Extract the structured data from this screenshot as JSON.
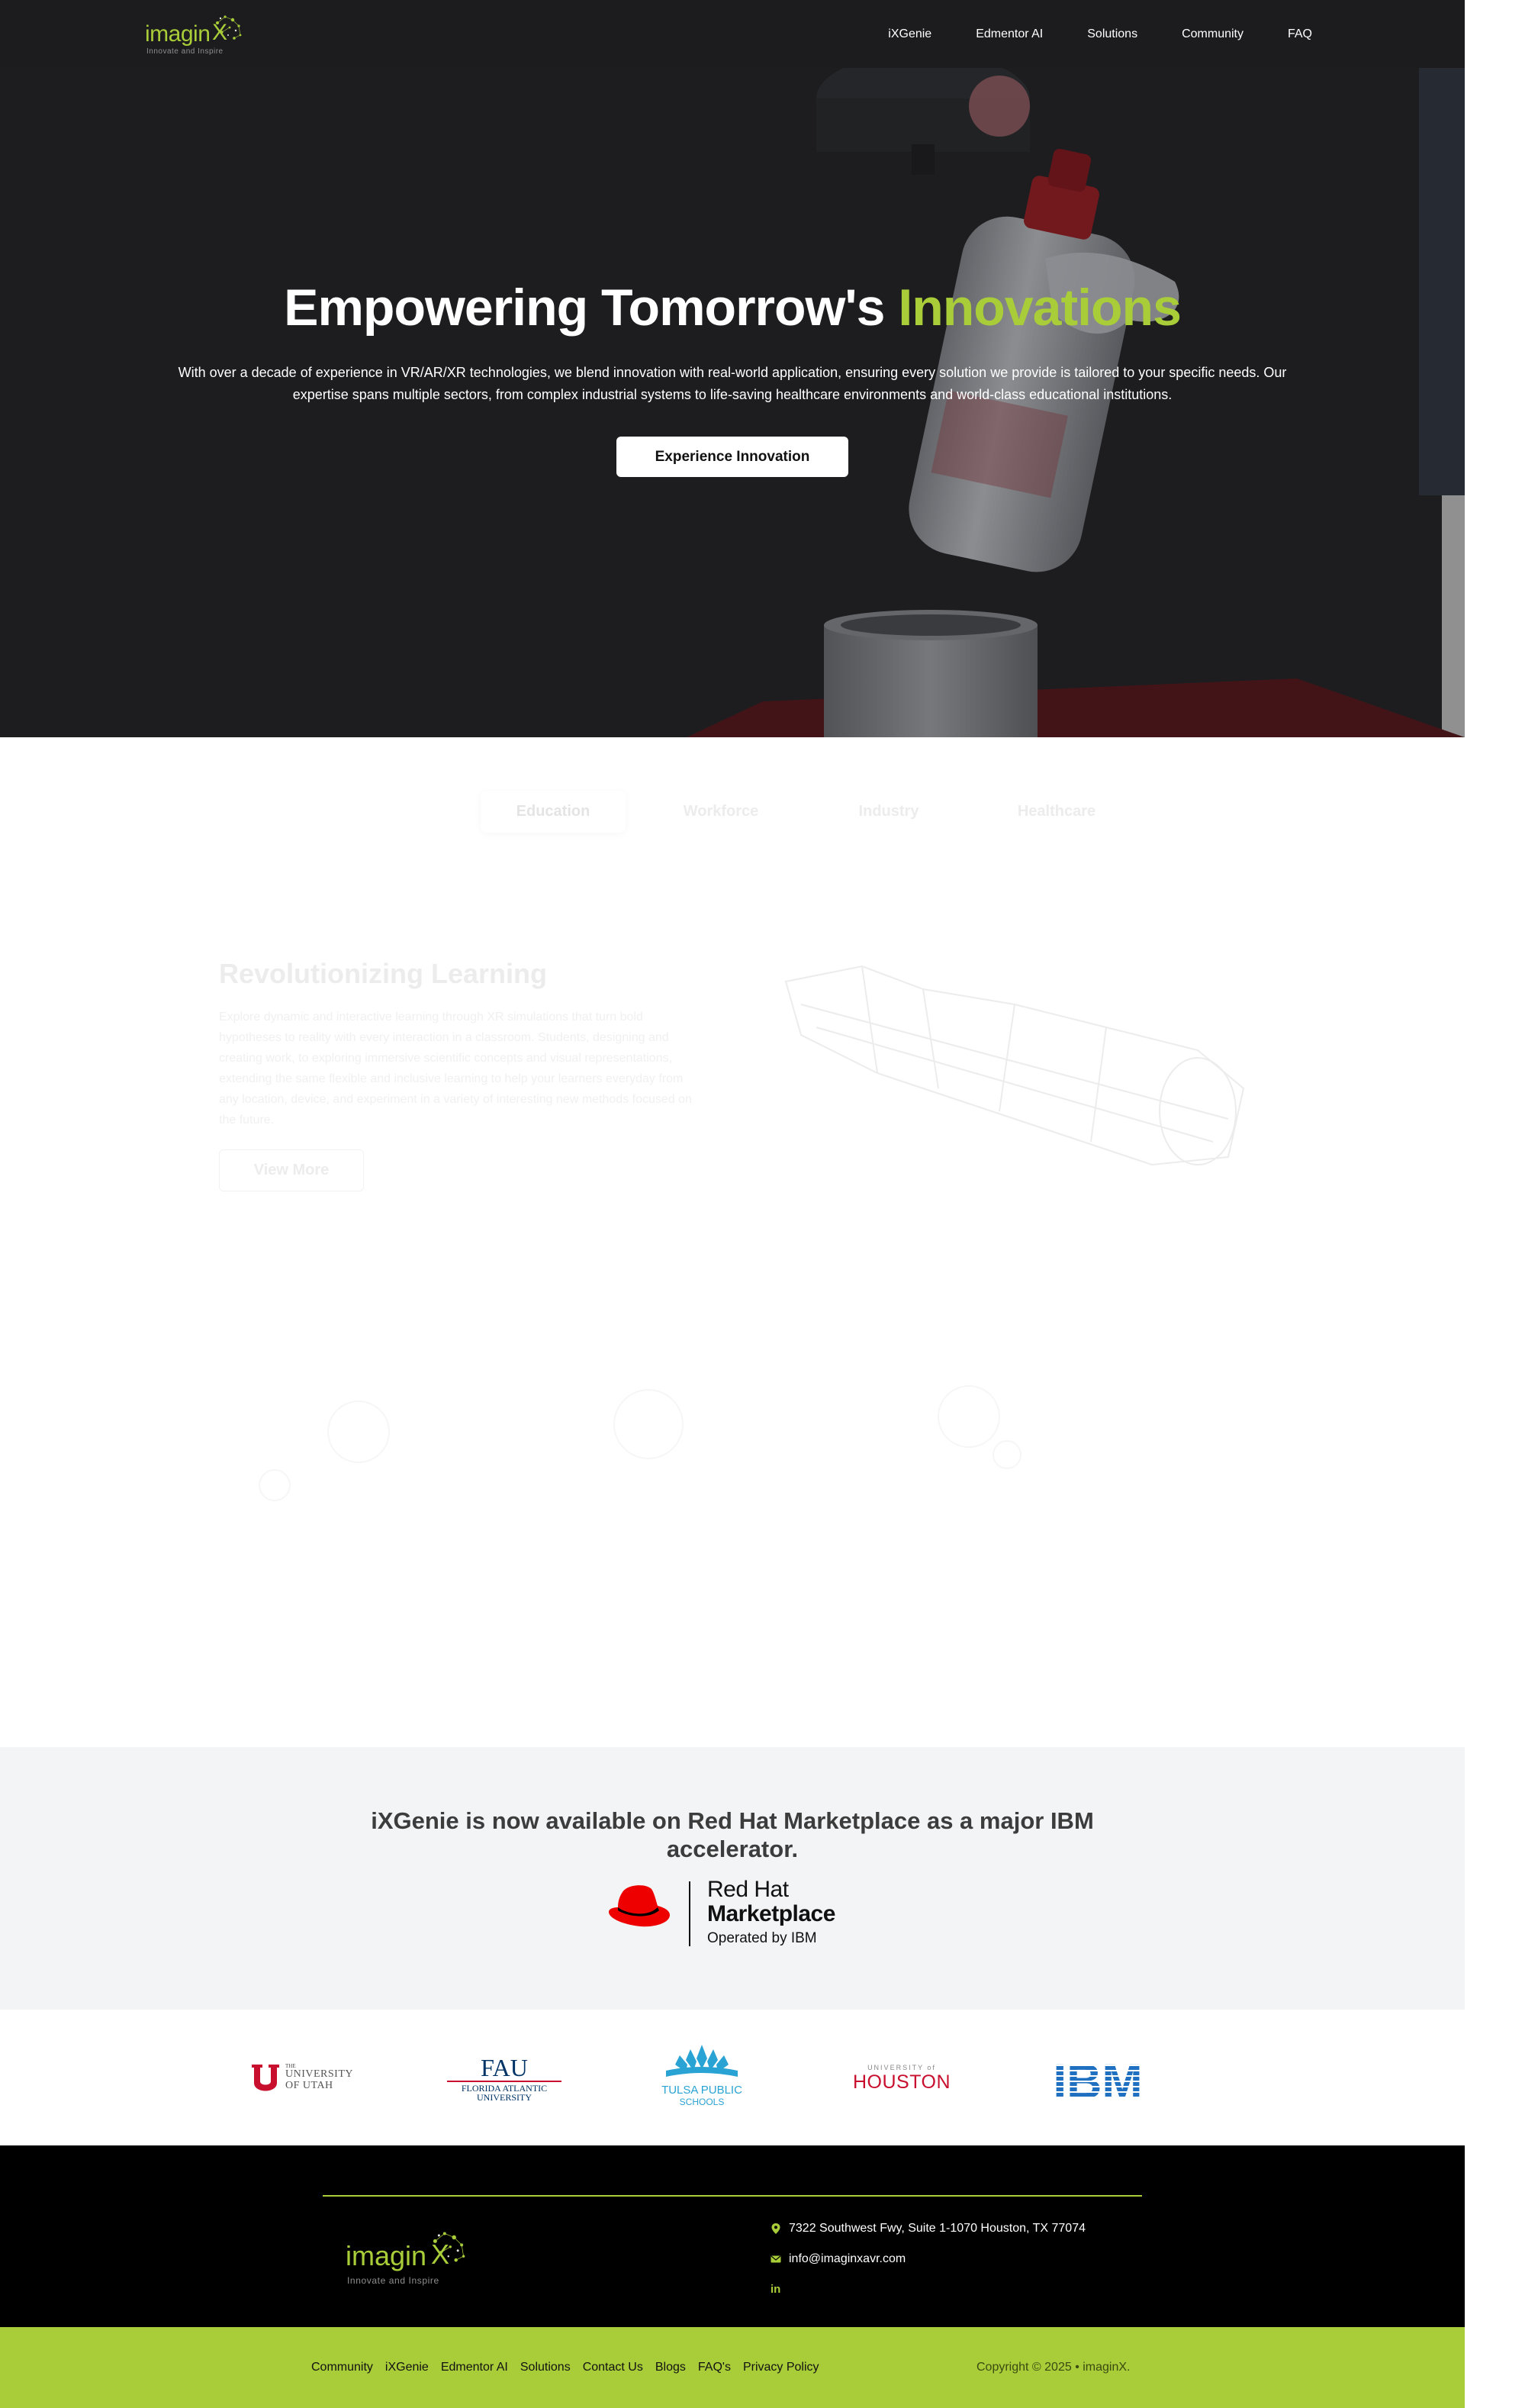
{
  "nav": {
    "logo_word": "imagin",
    "logo_x": "X",
    "logo_tagline": "Innovate and Inspire",
    "links": [
      "iXGenie",
      "Edmentor AI",
      "Solutions",
      "Community",
      "FAQ"
    ]
  },
  "hero": {
    "title_main": "Empowering Tomorrow's ",
    "title_accent": "Innovations",
    "description": "With over a decade of experience in VR/AR/XR technologies, we blend innovation with real-world application, ensuring every solution we provide is tailored to your specific needs. Our expertise spans multiple sectors, from complex industrial systems to life-saving healthcare environments and world-class educational institutions.",
    "cta_label": "Experience Innovation"
  },
  "sectors": {
    "tabs": [
      "Education",
      "Workforce",
      "Industry",
      "Healthcare"
    ],
    "active_tab": "Education",
    "title": "Revolutionizing Learning",
    "body": "Explore dynamic and interactive learning through XR simulations that turn bold hypotheses to reality with every interaction in a classroom. Students, designing and creating work, to exploring immersive scientific concepts and visual representations, extending the same flexible and inclusive learning to help your learners everyday from any location, device, and experiment in a variety of interesting new methods focused on the future.",
    "button_label": "View More"
  },
  "banner": {
    "title": "iXGenie is now available on Red Hat Marketplace as a major IBM accelerator.",
    "rh_line1": "Red Hat",
    "rh_line2": "Marketplace",
    "rh_line3": "Operated by IBM"
  },
  "partners": {
    "utah_small": "THE",
    "utah_line1": "UNIVERSITY",
    "utah_line2": "OF UTAH",
    "fau_mark": "FAU",
    "fau_line1": "FLORIDA ATLANTIC",
    "fau_line2": "UNIVERSITY",
    "tulsa_line1": "TULSA PUBLIC",
    "tulsa_line2": "SCHOOLS",
    "houston_small": "UNIVERSITY of",
    "houston_main": "HOUSTON",
    "ibm": "IBM"
  },
  "footer": {
    "logo_word": "imagin",
    "logo_x": "X",
    "logo_tagline": "Innovate and Inspire",
    "address": "7322 Southwest Fwy, Suite 1-1070 Houston, TX 77074",
    "email": "info@imaginxavr.com",
    "social": "in",
    "links": [
      "Community",
      "iXGenie",
      "Edmentor AI",
      "Solutions",
      "Contact Us",
      "Blogs",
      "FAQ's",
      "Privacy Policy"
    ],
    "copyright": "Copyright © 2025 • imaginX."
  },
  "colors": {
    "accent": "#a9cd39",
    "nav_bg": "#1c1c1e",
    "footer_bg": "#000000",
    "banner_bg": "#f3f4f6",
    "redhat": "#ee0000",
    "ibm_blue": "#1f70c1"
  }
}
